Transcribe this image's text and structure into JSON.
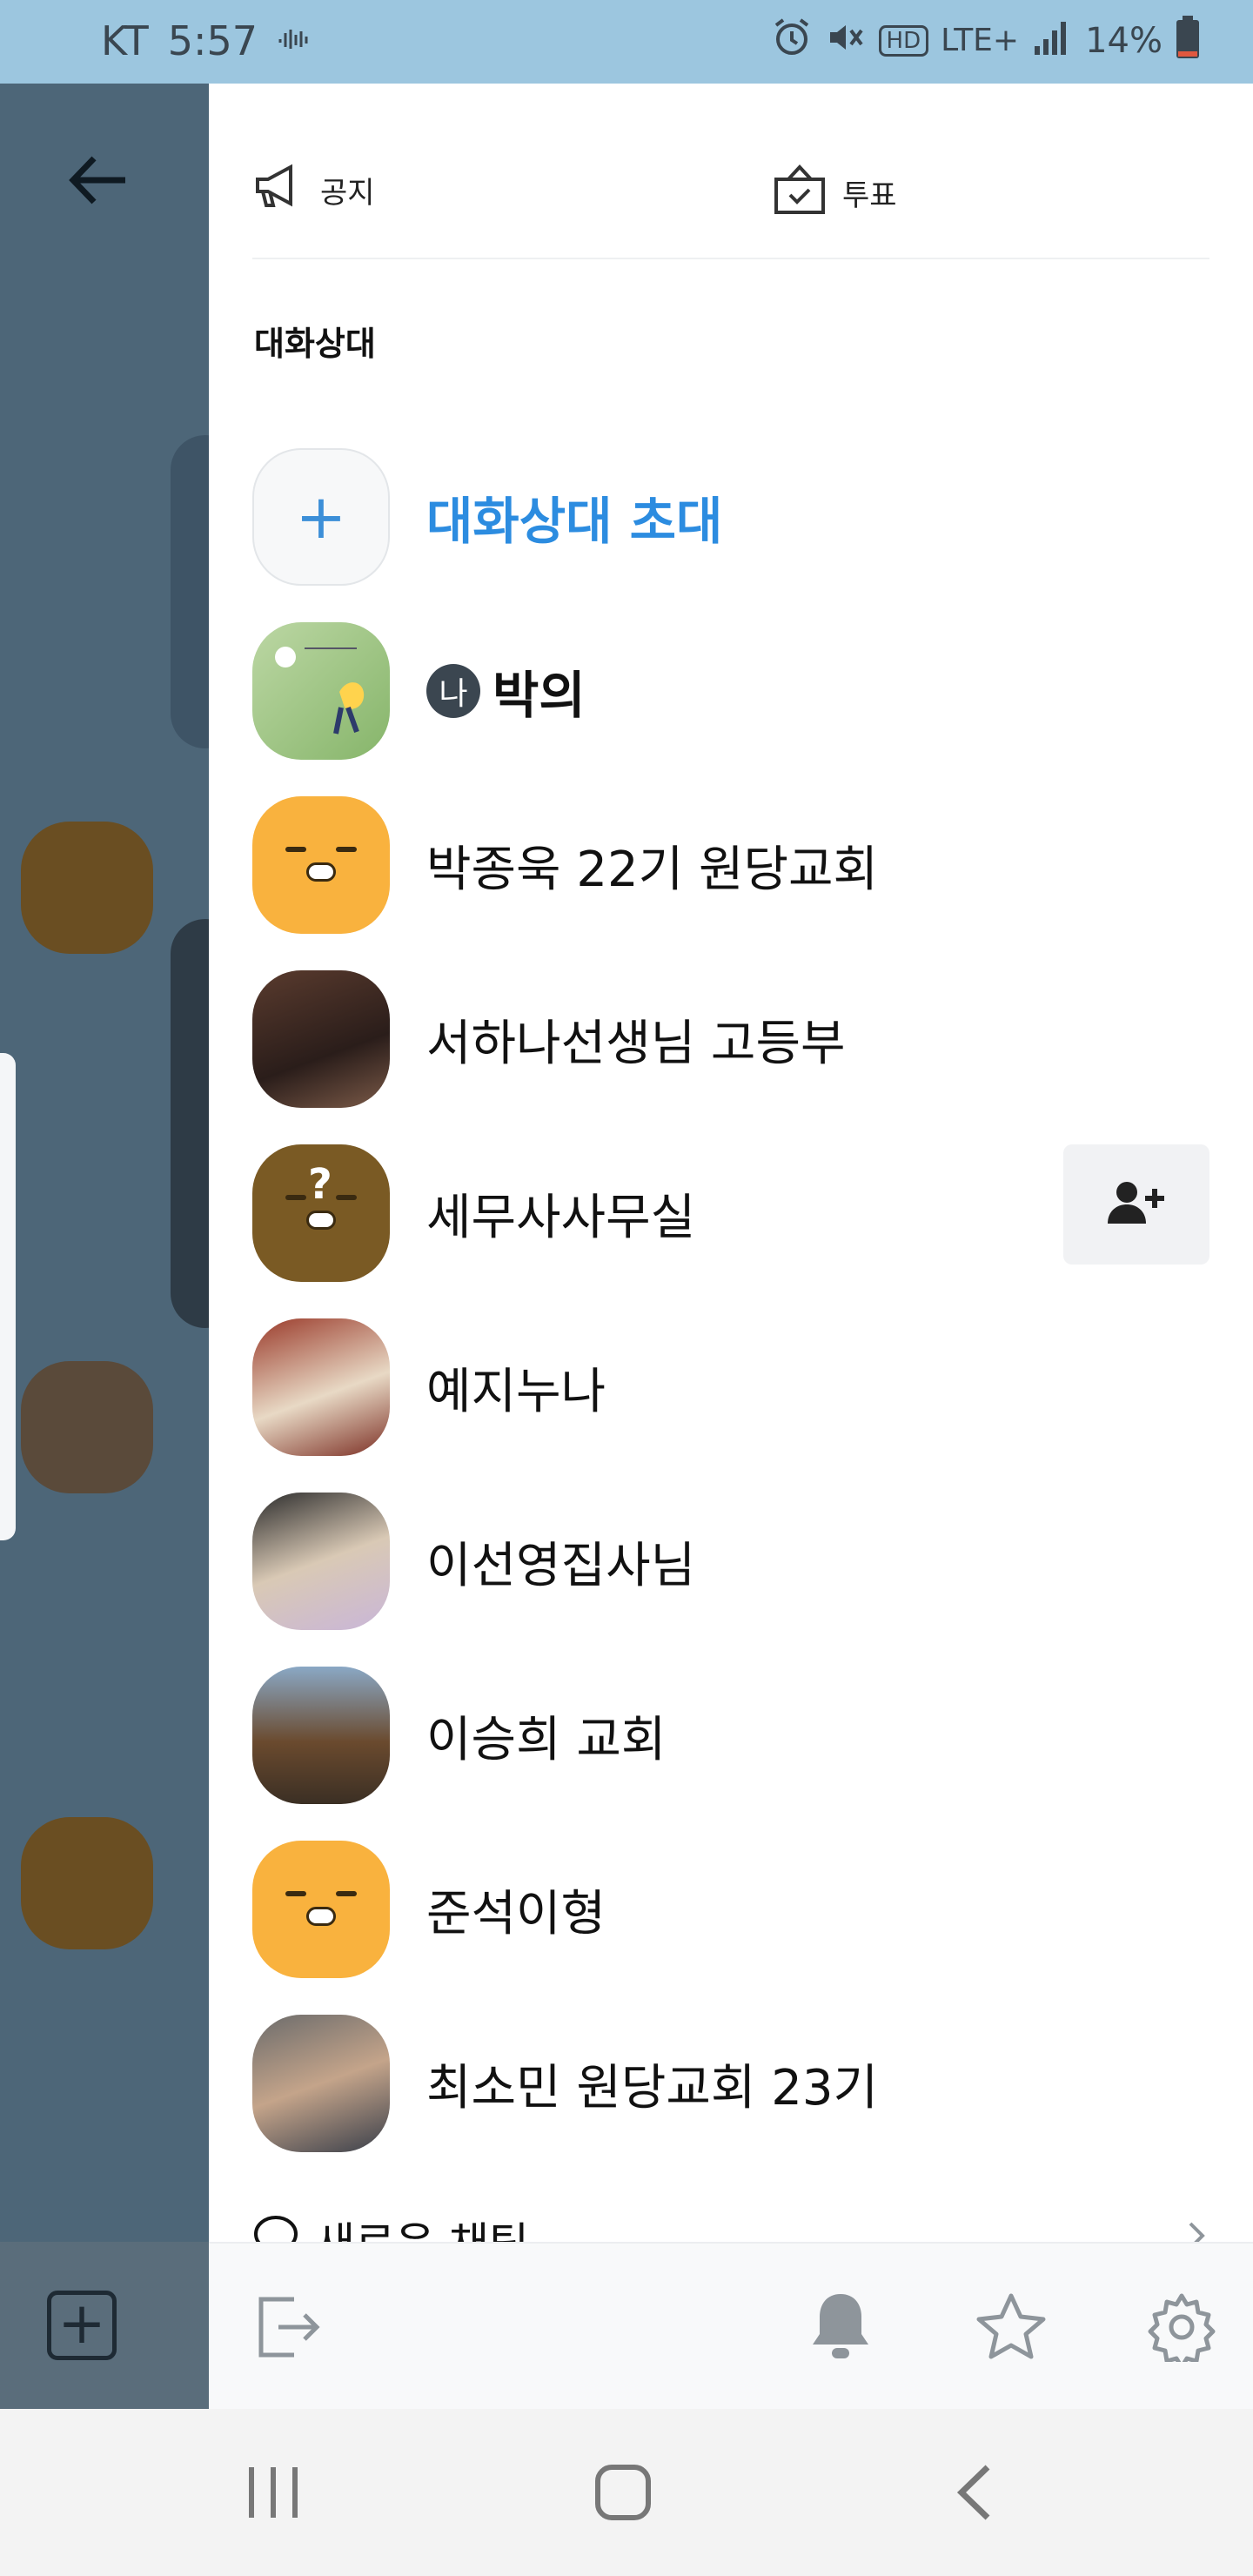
{
  "status_bar": {
    "carrier": "KT",
    "time": "5:57",
    "network": "LTE+",
    "hd": "HD",
    "battery_percent": "14%",
    "battery_level": 0.14
  },
  "top_actions": {
    "notice_label": "공지",
    "vote_label": "투표"
  },
  "members_section": {
    "title": "대화상대",
    "invite_label": "대화상대 초대",
    "me_badge": "나",
    "members": [
      {
        "name": "박의",
        "is_me": true
      },
      {
        "name": "박종욱 22기 원당교회"
      },
      {
        "name": "서하나선생님 고등부"
      },
      {
        "name": "세무사사무실",
        "show_add_friend": true
      },
      {
        "name": "예지누나"
      },
      {
        "name": "이선영집사님"
      },
      {
        "name": "이승희 교회"
      },
      {
        "name": "준석이형"
      },
      {
        "name": "최소민 원당교회 23기"
      }
    ]
  },
  "new_chat_label": "새로운 채팅",
  "icons": {
    "notice": "megaphone-icon",
    "vote": "ballot-box-icon",
    "add_friend": "add-person-icon",
    "leave": "exit-icon",
    "bell": "bell-icon",
    "star": "star-icon",
    "settings": "gear-icon"
  },
  "colors": {
    "accent": "#2c8ce0",
    "status_bar": "#9cc6df"
  }
}
